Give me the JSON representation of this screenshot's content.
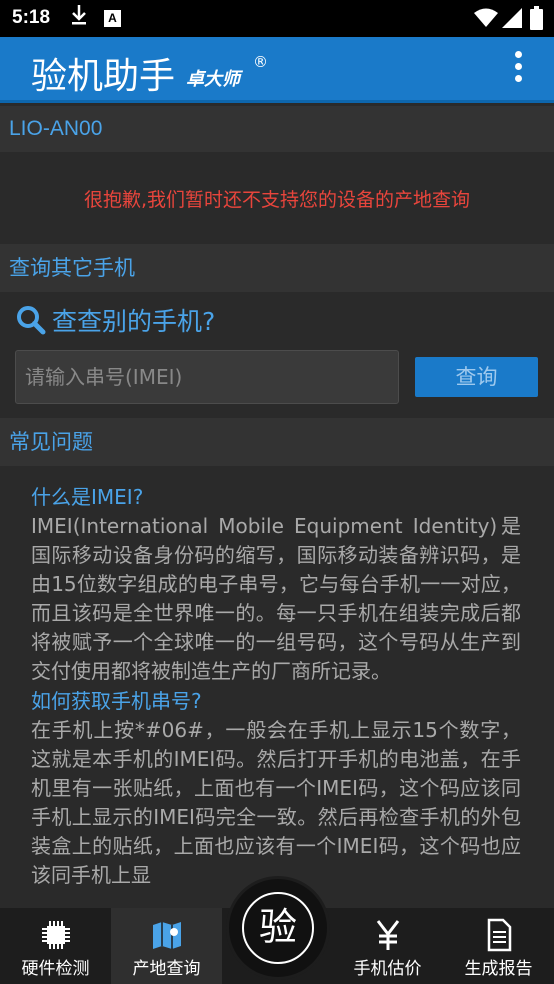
{
  "status_bar": {
    "time": "5:18",
    "a_badge": "A"
  },
  "app_bar": {
    "title": "验机助手",
    "subtitle": "卓大师",
    "registered": "®"
  },
  "device": {
    "model": "LIO-AN00"
  },
  "message": {
    "text": "很抱歉,我们暂时还不支持您的设备的产地查询"
  },
  "other_phone": {
    "section_title": "查询其它手机",
    "query_title": "查查别的手机?",
    "input_placeholder": "请输入串号(IMEI)",
    "query_button": "查询"
  },
  "faq": {
    "section_title": "常见问题",
    "items": [
      {
        "question": "什么是IMEI?",
        "answer": "IMEI(International Mobile Equipment Identity)是国际移动设备身份码的缩写，国际移动装备辨识码，是由15位数字组成的电子串号，它与每台手机一一对应，而且该码是全世界唯一的。每一只手机在组装完成后都将被赋予一个全球唯一的一组号码，这个号码从生产到交付使用都将被制造生产的厂商所记录。"
      },
      {
        "question": "如何获取手机串号?",
        "answer": "在手机上按*#06#，一般会在手机上显示15个数字，这就是本手机的IMEI码。然后打开手机的电池盖，在手机里有一张贴纸，上面也有一个IMEI码，这个码应该同手机上显示的IMEI码完全一致。然后再检查手机的外包装盒上的贴纸，上面也应该有一个IMEI码，这个码也应该同手机上显"
      }
    ]
  },
  "bottom_nav": {
    "items": [
      {
        "label": "硬件检测",
        "icon": "chip-icon"
      },
      {
        "label": "产地查询",
        "icon": "map-icon",
        "active": true
      },
      {
        "label": "手机估价",
        "icon": "yen-icon"
      },
      {
        "label": "生成报告",
        "icon": "report-icon"
      }
    ],
    "center_label": "验"
  },
  "colors": {
    "accent": "#1a7ac9",
    "link": "#4aa3e8",
    "error": "#e8453c"
  }
}
